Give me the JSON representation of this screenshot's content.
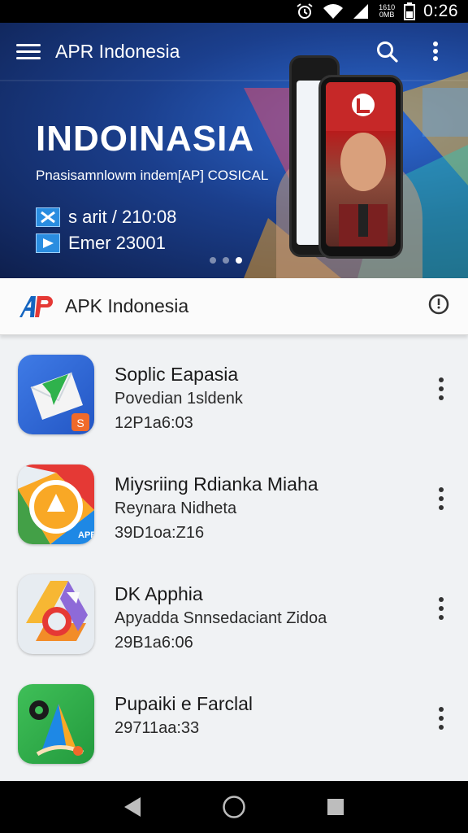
{
  "status_bar": {
    "time": "0:26",
    "tiny_text": "1610\n0MB",
    "icons": [
      "alarm-icon",
      "wifi-icon",
      "signal-icon",
      "battery-icon"
    ]
  },
  "app_bar": {
    "title": "APR Indonesia",
    "icons": [
      "menu-icon",
      "search-icon",
      "more-vert-icon"
    ]
  },
  "banner": {
    "headline": "INDOINASIA",
    "subtitle": "Pnasisamnlowm indem[AP] COSICAL",
    "line1": "s arit / 210:08",
    "line2": "Emer 23001",
    "pager": {
      "count": 3,
      "active": 2
    }
  },
  "section": {
    "name": "APK Indonesia",
    "icons": [
      "ap-logo-icon",
      "clock-icon"
    ]
  },
  "apps": [
    {
      "title": "Soplic Eapasia",
      "subtitle": "Povedian 1sldenk",
      "meta": "12P1a6:03",
      "icon": "envelope-app-icon"
    },
    {
      "title": "Miysriing Rdianka Miaha",
      "subtitle": "Reynara Nidheta",
      "meta": "39D1oa:Z16",
      "icon": "drive-app-icon"
    },
    {
      "title": "DK Apphia",
      "subtitle": "Apyadda Snnsedaciant Zidoa",
      "meta": "29B1a6:06",
      "icon": "chrome-app-icon"
    },
    {
      "title": "Pupaiki e Farclal",
      "subtitle": "",
      "meta": "29711aa:33",
      "icon": "maps-app-icon"
    }
  ],
  "colors": {
    "hero_dark": "#0e1f4d",
    "hero_blue": "#2e6bd3",
    "list_bg": "#f0f2f4",
    "header_bg": "#fbfbfb",
    "accent_blue": "#1565c0",
    "accent_red": "#e53935"
  },
  "nav": {
    "icons": [
      "back-icon",
      "home-icon",
      "recents-icon"
    ]
  }
}
